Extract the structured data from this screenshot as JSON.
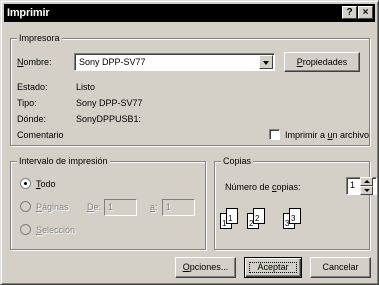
{
  "title": "Imprimir",
  "title_buttons": {
    "help": "?",
    "close": "×"
  },
  "printer_group": {
    "label": "Impresora",
    "name_label": "Nombre:",
    "name_value": "Sony DPP-SV77",
    "properties_button": "Propiedades",
    "status_label": "Estado:",
    "status_value": "Listo",
    "type_label": "Tipo:",
    "type_value": "Sony DPP-SV77",
    "where_label": "Dónde:",
    "where_value": "SonyDPPUSB1:",
    "comment_label": "Comentario",
    "print_to_file_label": "Imprimir a un archivo"
  },
  "range_group": {
    "label": "Intervalo de impresión",
    "all_label": "Todo",
    "pages_label": "Páginas",
    "from_label": "De:",
    "from_value": "1",
    "to_label": "a:",
    "to_value": "1",
    "selection_label": "Selección"
  },
  "copies_group": {
    "label": "Copias",
    "count_label": "Número de copias:",
    "count_value": "1",
    "collate_pages": [
      "1",
      "1",
      "2",
      "2",
      "3",
      "3"
    ]
  },
  "buttons": {
    "options": "Opciones...",
    "accept": "Aceptar",
    "cancel": "Cancelar"
  }
}
